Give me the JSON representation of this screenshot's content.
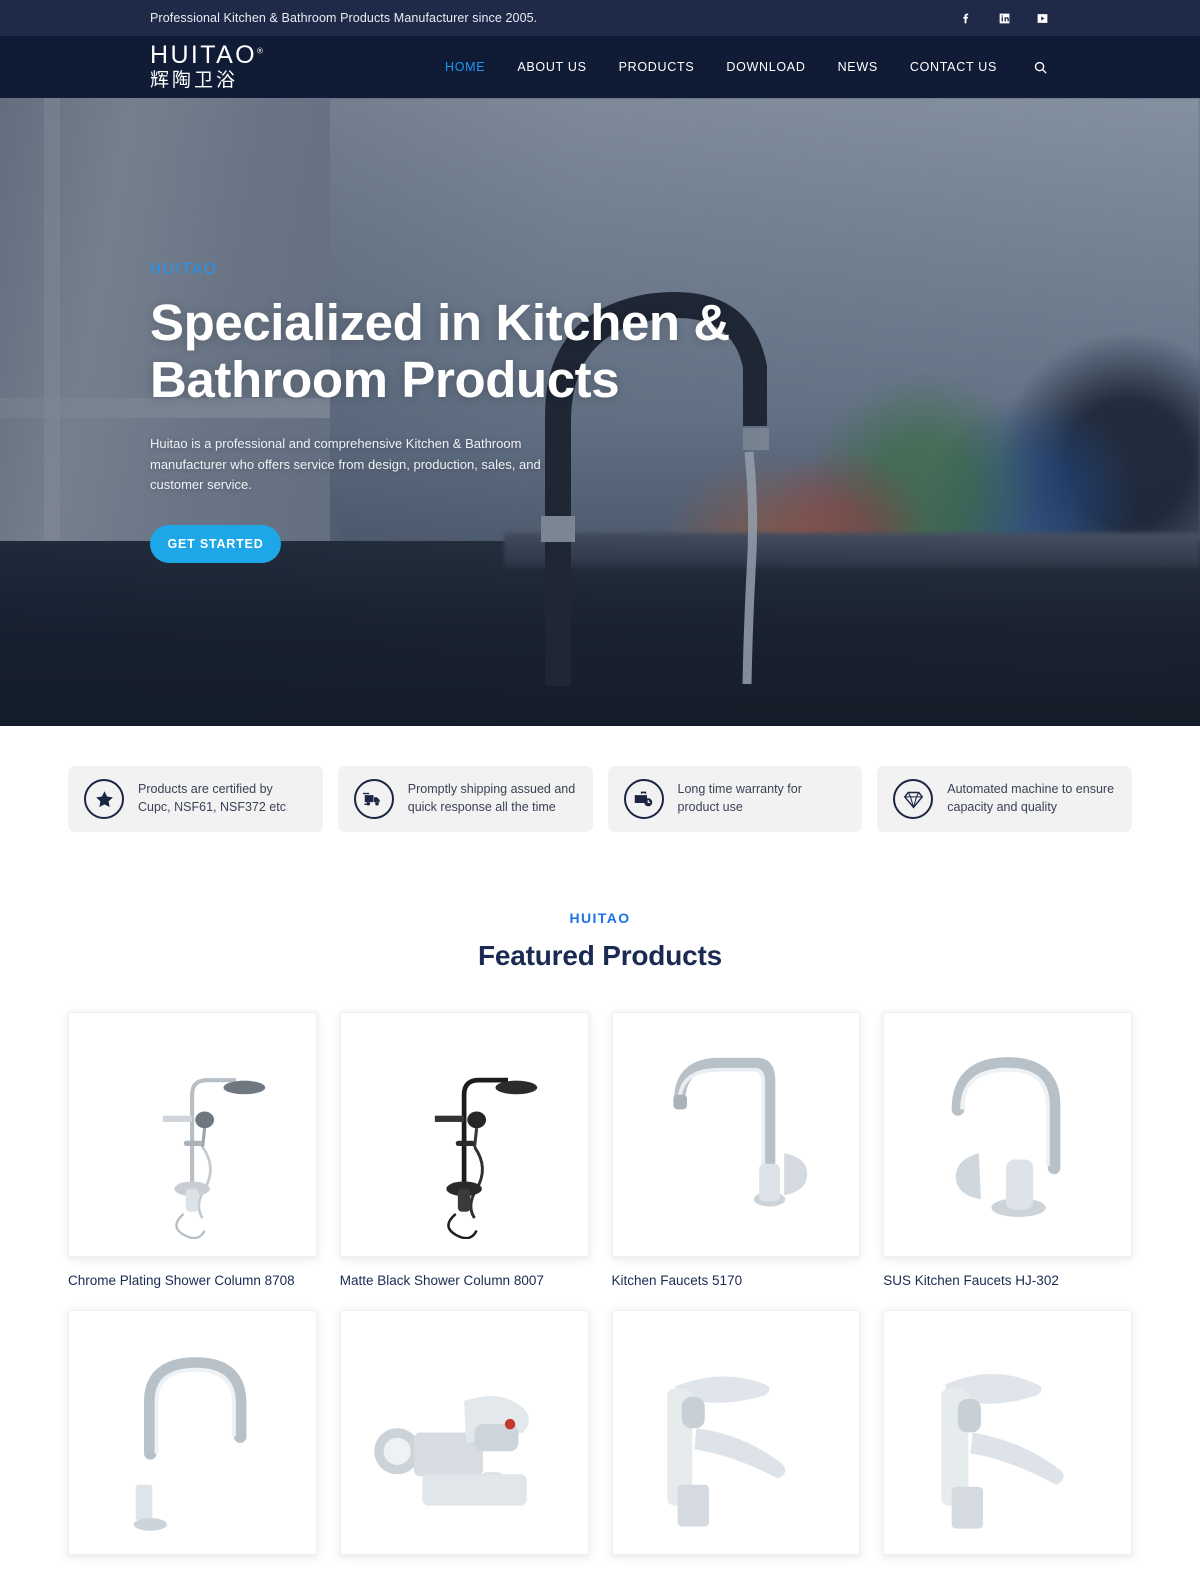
{
  "topbar": {
    "tagline": "Professional Kitchen & Bathroom Products Manufacturer since 2005.",
    "social": [
      {
        "name": "facebook",
        "label": "Facebook"
      },
      {
        "name": "linkedin",
        "label": "LinkedIn"
      },
      {
        "name": "youtube",
        "label": "YouTube"
      }
    ]
  },
  "brand": {
    "name": "HUITAO",
    "registered": "®",
    "name_cn": "辉陶卫浴"
  },
  "nav": {
    "items": [
      {
        "label": "HOME",
        "active": true
      },
      {
        "label": "ABOUT US",
        "active": false
      },
      {
        "label": "PRODUCTS",
        "active": false
      },
      {
        "label": "DOWNLOAD",
        "active": false
      },
      {
        "label": "NEWS",
        "active": false
      },
      {
        "label": "CONTACT US",
        "active": false
      }
    ],
    "search_icon": "search-icon"
  },
  "hero": {
    "eyebrow": "HUITAO",
    "title": "Specialized in Kitchen & Bathroom Products",
    "description": "Huitao is a professional and comprehensive Kitchen & Bathroom manufacturer who offers service from design, production, sales, and customer service.",
    "cta_label": "GET STARTED"
  },
  "features": [
    {
      "icon": "star-icon",
      "text": "Products are certified by Cupc, NSF61, NSF372 etc"
    },
    {
      "icon": "truck-icon",
      "text": "Promptly shipping assued and quick response all the time"
    },
    {
      "icon": "briefcase-clock-icon",
      "text": "Long time warranty for product use"
    },
    {
      "icon": "diamond-icon",
      "text": "Automated machine to ensure capacity and quality"
    }
  ],
  "featured": {
    "eyebrow": "HUITAO",
    "title": "Featured Products",
    "products": [
      {
        "name": "Chrome Plating Shower Column 8708",
        "image": "shower-column-chrome"
      },
      {
        "name": "Matte Black Shower Column 8007",
        "image": "shower-column-black"
      },
      {
        "name": "Kitchen Faucets 5170",
        "image": "kitchen-faucet-square-arch"
      },
      {
        "name": "SUS Kitchen Faucets HJ-302",
        "image": "kitchen-faucet-curved"
      },
      {
        "name": "",
        "image": "kitchen-faucet-gooseneck"
      },
      {
        "name": "",
        "image": "bath-shower-mixer"
      },
      {
        "name": "",
        "image": "basin-mixer-a"
      },
      {
        "name": "",
        "image": "basin-mixer-b"
      }
    ]
  },
  "colors": {
    "topbar_bg": "#1e2a47",
    "nav_bg": "#101b35",
    "accent_blue": "#2196f3",
    "cta_blue": "#1ea7e8",
    "heading_navy": "#1b2a52",
    "feature_card_bg": "#f2f2f2"
  }
}
